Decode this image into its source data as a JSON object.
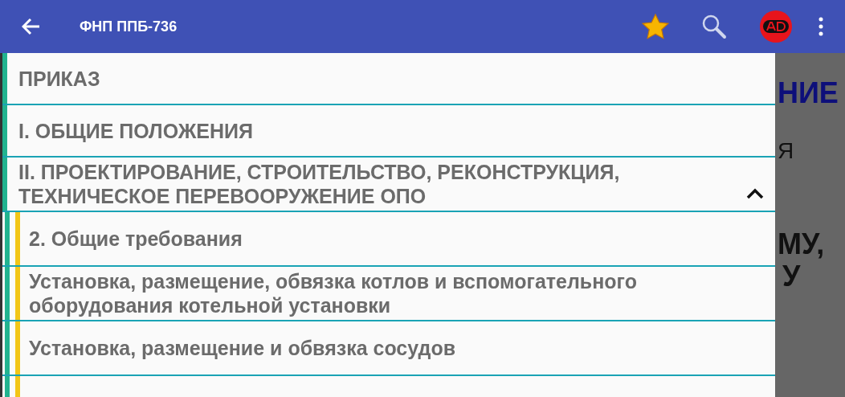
{
  "app_bar": {
    "title": "ФНП ППБ-736"
  },
  "background_document": [
    {
      "text": "НИЕ",
      "kind": "heading"
    },
    {
      "text": "Я",
      "kind": "plain"
    },
    {
      "text": "МУ,",
      "kind": "bold"
    },
    {
      "text": "У",
      "kind": "bold"
    }
  ],
  "drawer": {
    "items": [
      {
        "label": "ПРИКАЗ"
      },
      {
        "label": "I. ОБЩИЕ ПОЛОЖЕНИЯ"
      },
      {
        "label": "II. ПРОЕКТИРОВАНИЕ, СТРОИТЕЛЬСТВО, РЕКОНСТРУКЦИЯ, ТЕХНИЧЕСКОЕ ПЕРЕВООРУЖЕНИЕ ОПО",
        "expanded": true,
        "children": [
          {
            "label": "2. Общие требования"
          },
          {
            "label": "Установка, размещение, обвязка котлов и вспомогательного оборудования котельной установки"
          },
          {
            "label": "Установка, размещение и обвязка сосудов"
          }
        ]
      }
    ]
  }
}
